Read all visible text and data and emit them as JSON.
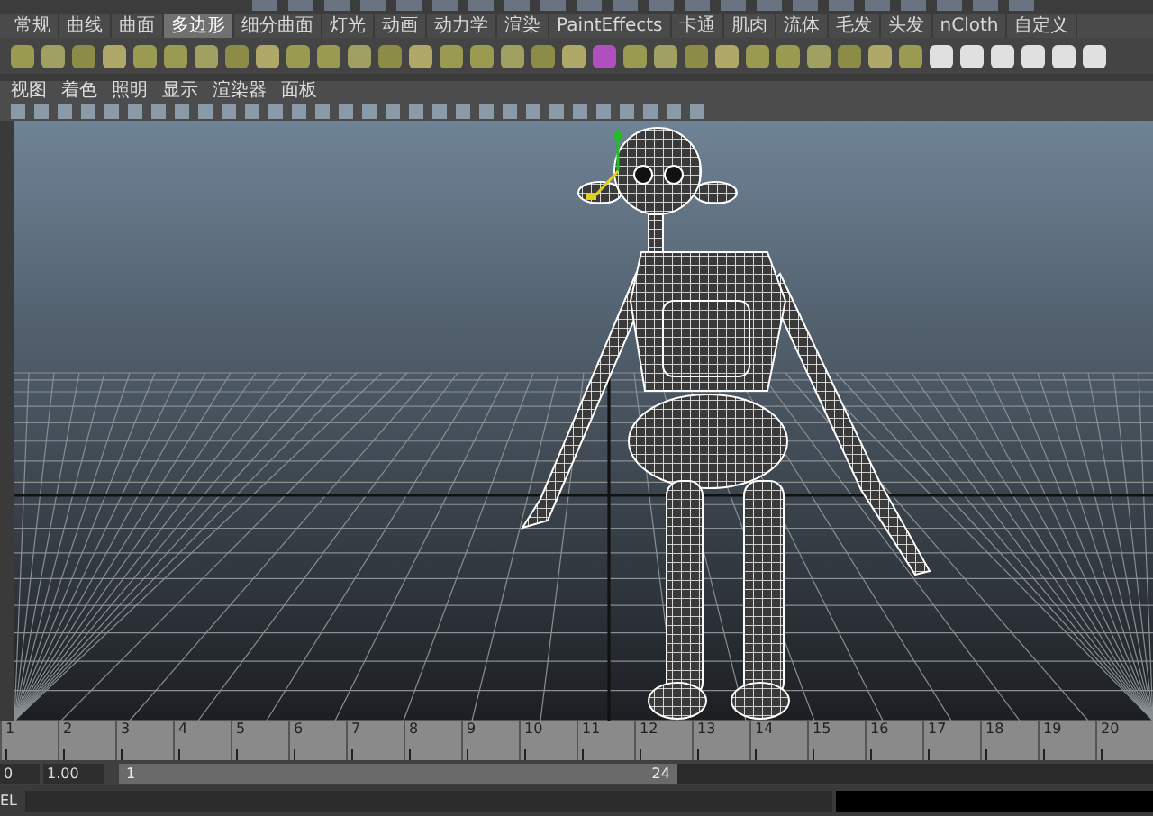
{
  "shelf": {
    "tabs": [
      {
        "label": "常规",
        "selected": false
      },
      {
        "label": "曲线",
        "selected": false
      },
      {
        "label": "曲面",
        "selected": false
      },
      {
        "label": "多边形",
        "selected": true
      },
      {
        "label": "细分曲面",
        "selected": false
      },
      {
        "label": "灯光",
        "selected": false
      },
      {
        "label": "动画",
        "selected": false
      },
      {
        "label": "动力学",
        "selected": false
      },
      {
        "label": "渲染",
        "selected": false
      },
      {
        "label": "PaintEffects",
        "selected": false
      },
      {
        "label": "卡通",
        "selected": false
      },
      {
        "label": "肌肉",
        "selected": false
      },
      {
        "label": "流体",
        "selected": false
      },
      {
        "label": "毛发",
        "selected": false
      },
      {
        "label": "头发",
        "selected": false
      },
      {
        "label": "nCloth",
        "selected": false
      },
      {
        "label": "自定义",
        "selected": false
      }
    ]
  },
  "viewport": {
    "menu": [
      "视图",
      "着色",
      "照明",
      "显示",
      "渲染器",
      "面板"
    ]
  },
  "timeline": {
    "ticks": [
      "1",
      "2",
      "3",
      "4",
      "5",
      "6",
      "7",
      "8",
      "9",
      "10",
      "11",
      "12",
      "13",
      "14",
      "15",
      "16",
      "17",
      "18",
      "19",
      "20"
    ]
  },
  "range": {
    "start_field": "0",
    "current_field": "1.00",
    "slider_start": "1",
    "slider_end": "24",
    "level": 0.54
  },
  "command_line": {
    "label": "EL"
  }
}
